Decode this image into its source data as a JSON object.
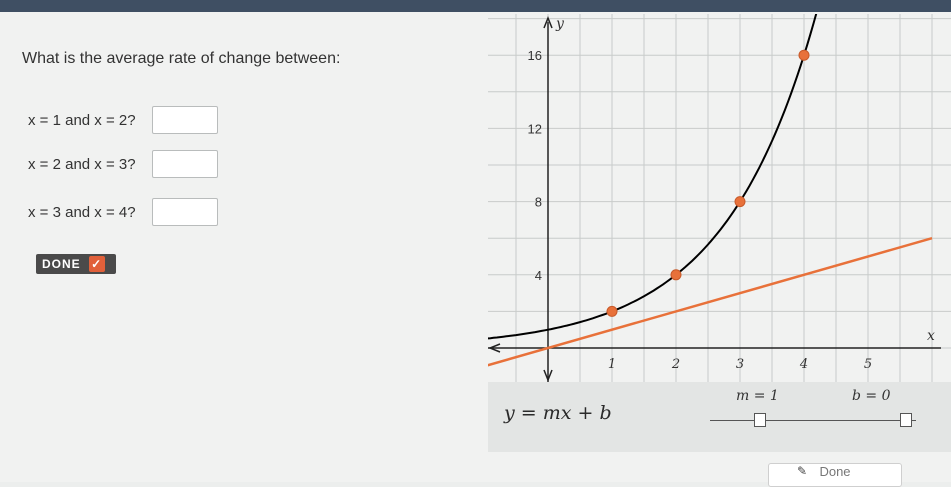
{
  "question": {
    "prompt": "What is the average rate of change between:",
    "rows": [
      {
        "label": "x = 1 and x = 2?"
      },
      {
        "label": "x = 2 and x = 3?"
      },
      {
        "label": "x = 3 and x = 4?"
      }
    ],
    "done_label": "DONE",
    "done_check": "✓"
  },
  "graph": {
    "y_axis_label": "y",
    "x_axis_label": "x",
    "y_ticks": [
      "4",
      "8",
      "12",
      "16"
    ],
    "x_ticks": [
      "1",
      "2",
      "3",
      "4",
      "5"
    ],
    "colors": {
      "curve": "#000000",
      "line": "#e8713a",
      "points": "#e8713a",
      "grid": "#c8cbca",
      "axis": "#222222"
    }
  },
  "chart_data": {
    "type": "line",
    "x_axis_label": "x",
    "y_axis_label": "y",
    "xlim": [
      -1,
      6
    ],
    "ylim": [
      -1,
      19
    ],
    "grid": true,
    "series": [
      {
        "x": [
          -1,
          0,
          1,
          2,
          3,
          4,
          4.5
        ],
        "y": [
          0.5,
          1,
          2,
          4,
          8,
          16,
          22.6
        ]
      },
      {
        "x": [
          -1,
          6
        ],
        "y": [
          -1,
          6
        ]
      }
    ],
    "points": {
      "x": [
        1,
        2,
        3,
        4
      ],
      "y": [
        2,
        4,
        8,
        16
      ]
    }
  },
  "equation": {
    "text": "y = mx + b",
    "m_label": "m = 1",
    "b_label": "b = 0"
  },
  "footer": {
    "done_label": "Done"
  }
}
